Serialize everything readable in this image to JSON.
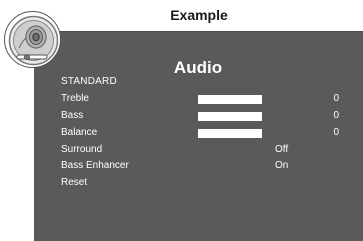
{
  "header": {
    "title": "Example"
  },
  "panel": {
    "title": "Audio",
    "mode": "STANDARD",
    "items": [
      {
        "label": "Treble",
        "value": "0",
        "has_bar": true,
        "level": 0.5
      },
      {
        "label": "Bass",
        "value": "0",
        "has_bar": true,
        "level": 0.5
      },
      {
        "label": "Balance",
        "value": "0",
        "has_bar": true,
        "level": 0.5
      },
      {
        "label": "Surround",
        "value": "Off",
        "has_bar": false
      },
      {
        "label": "Bass Enhancer",
        "value": "On",
        "has_bar": false
      },
      {
        "label": "Reset",
        "value": "",
        "has_bar": false
      }
    ]
  },
  "colors": {
    "panel_background": "#5a5a5a",
    "text": "#ffffff",
    "bar": "#ffffff",
    "header_text": "#1a1a1a"
  },
  "icons": {
    "menu_icon": "speaker-icon"
  }
}
